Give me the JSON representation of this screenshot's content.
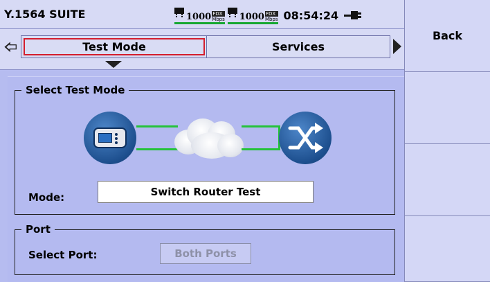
{
  "header": {
    "title": "Y.1564 SUITE",
    "port1": {
      "speed": "1000",
      "duplex": "FDX",
      "unit": "Mbps",
      "icon": "port-icon"
    },
    "port2": {
      "speed": "1000",
      "duplex": "FDX",
      "unit": "Mbps",
      "icon": "port-icon"
    },
    "clock": "08:54:24",
    "power_icon": "ac-power-icon",
    "link_color": "#16a832"
  },
  "tabs": [
    {
      "label": "Test Mode",
      "active": true
    },
    {
      "label": "Services",
      "active": false
    }
  ],
  "select_test_mode": {
    "legend": "Select Test Mode",
    "diagram": {
      "left_icon": "test-device-icon",
      "middle_icon": "network-cloud-icon",
      "right_icon": "switch-router-icon",
      "link_color": "#25c23a"
    },
    "mode_label": "Mode:",
    "mode_value": "Switch Router Test"
  },
  "port": {
    "legend": "Port",
    "select_label": "Select Port:",
    "select_value": "Both Ports",
    "enabled": false
  },
  "softkeys": [
    {
      "label": "Back"
    },
    {
      "label": ""
    },
    {
      "label": ""
    },
    {
      "label": ""
    }
  ],
  "colors": {
    "background": "#b6bcf0",
    "active_tab_outline": "#d41d2d",
    "accent_blue": "#1d4f8e"
  }
}
